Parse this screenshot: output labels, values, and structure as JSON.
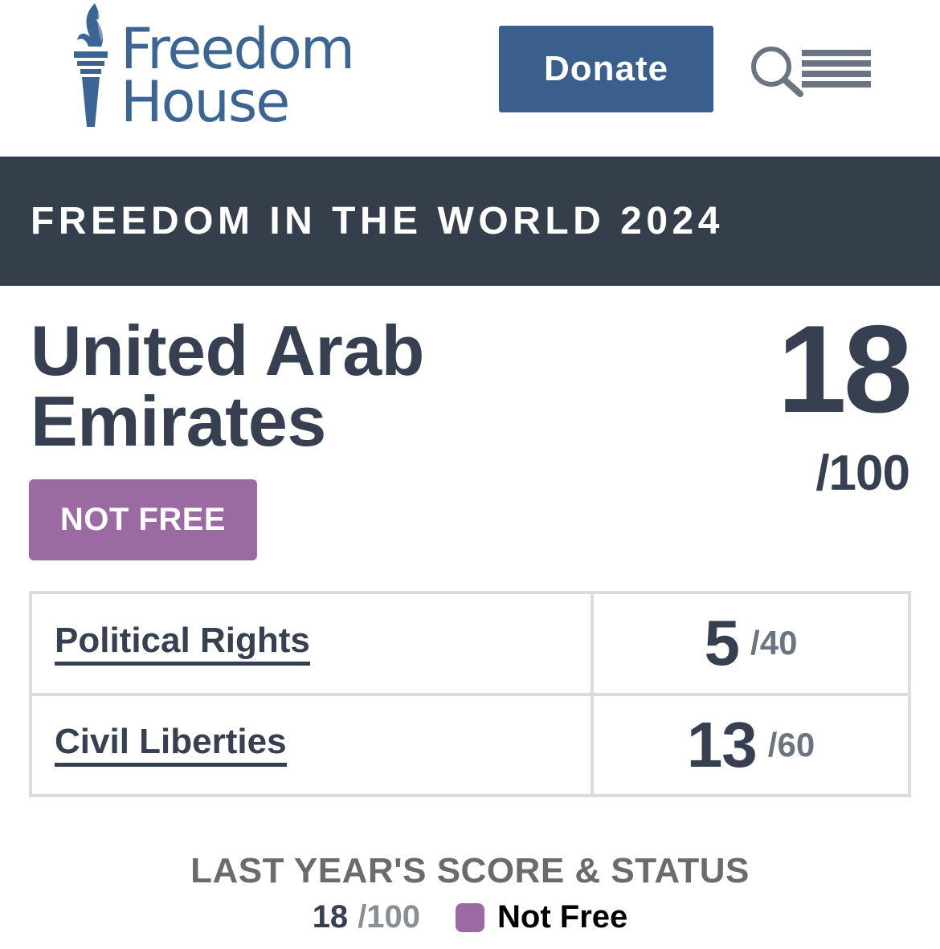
{
  "header": {
    "logo_line1": "Freedom",
    "logo_line2": "House",
    "donate_label": "Donate",
    "brand_color": "#3b6694",
    "donate_color": "#3a5f8c",
    "search_icon": "search-icon",
    "menu_icon": "hamburger-menu-icon"
  },
  "banner": {
    "title": "FREEDOM IN THE WORLD 2024",
    "background": "#353e4b"
  },
  "country": {
    "name_line1": "United Arab",
    "name_line2": "Emirates",
    "status": "NOT FREE",
    "status_color": "#9b6aa3",
    "total_score": "18",
    "total_max": "/100"
  },
  "scores": [
    {
      "label": "Political Rights",
      "score": "5",
      "max": "/40"
    },
    {
      "label": "Civil Liberties",
      "score": "13",
      "max": "/60"
    }
  ],
  "last_year": {
    "heading": "LAST YEAR'S SCORE & STATUS",
    "score": "18",
    "max": "/100",
    "status": "Not Free",
    "status_color": "#9b6aa3"
  }
}
